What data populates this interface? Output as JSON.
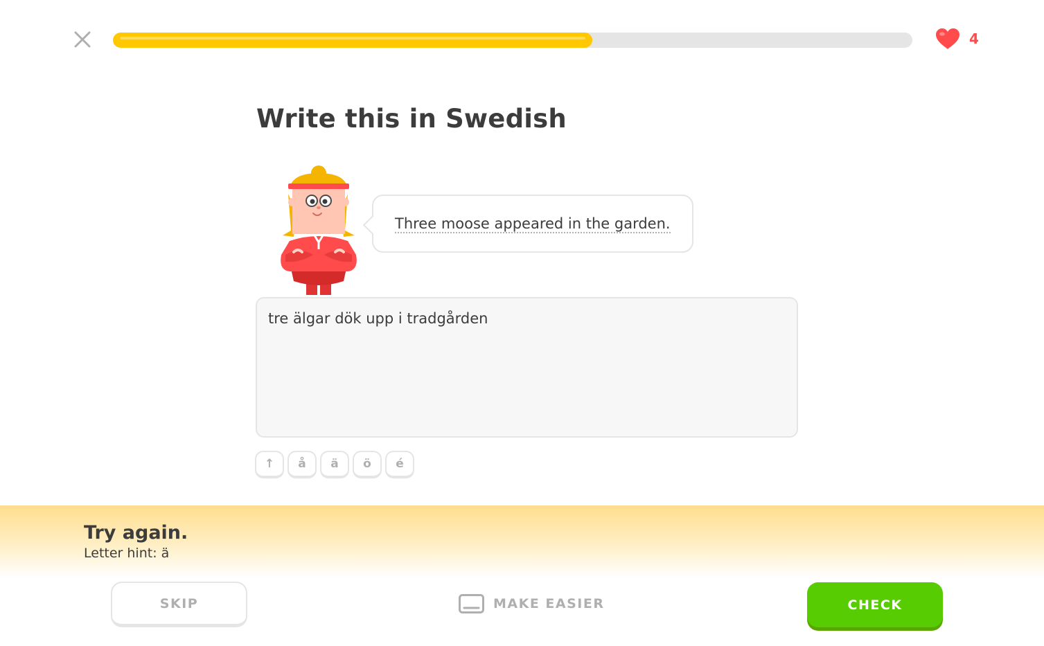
{
  "header": {
    "close_icon": "close-icon",
    "progress": 0.6,
    "hearts": {
      "icon": "heart-icon",
      "count": "4",
      "color": "#ff4b4b"
    }
  },
  "main": {
    "title": "Write this in Swedish",
    "character_icon": "lily-character",
    "prompt": "Three moose appeared in the garden.",
    "answer": "tre älgar dök upp i tradgården",
    "special_keys": [
      {
        "label": "↑",
        "icon": "shift-arrow-icon"
      },
      {
        "label": "å"
      },
      {
        "label": "ä"
      },
      {
        "label": "ö"
      },
      {
        "label": "é"
      }
    ]
  },
  "feedback": {
    "title": "Try again.",
    "hint": "Letter hint: ä"
  },
  "footer": {
    "skip_label": "SKIP",
    "make_easier_label": "MAKE EASIER",
    "make_easier_icon": "keyboard-icon",
    "check_label": "CHECK"
  },
  "colors": {
    "progress_fill": "#ffc800",
    "check_button": "#58cc02",
    "feedback_background": "#ffdd8e"
  }
}
